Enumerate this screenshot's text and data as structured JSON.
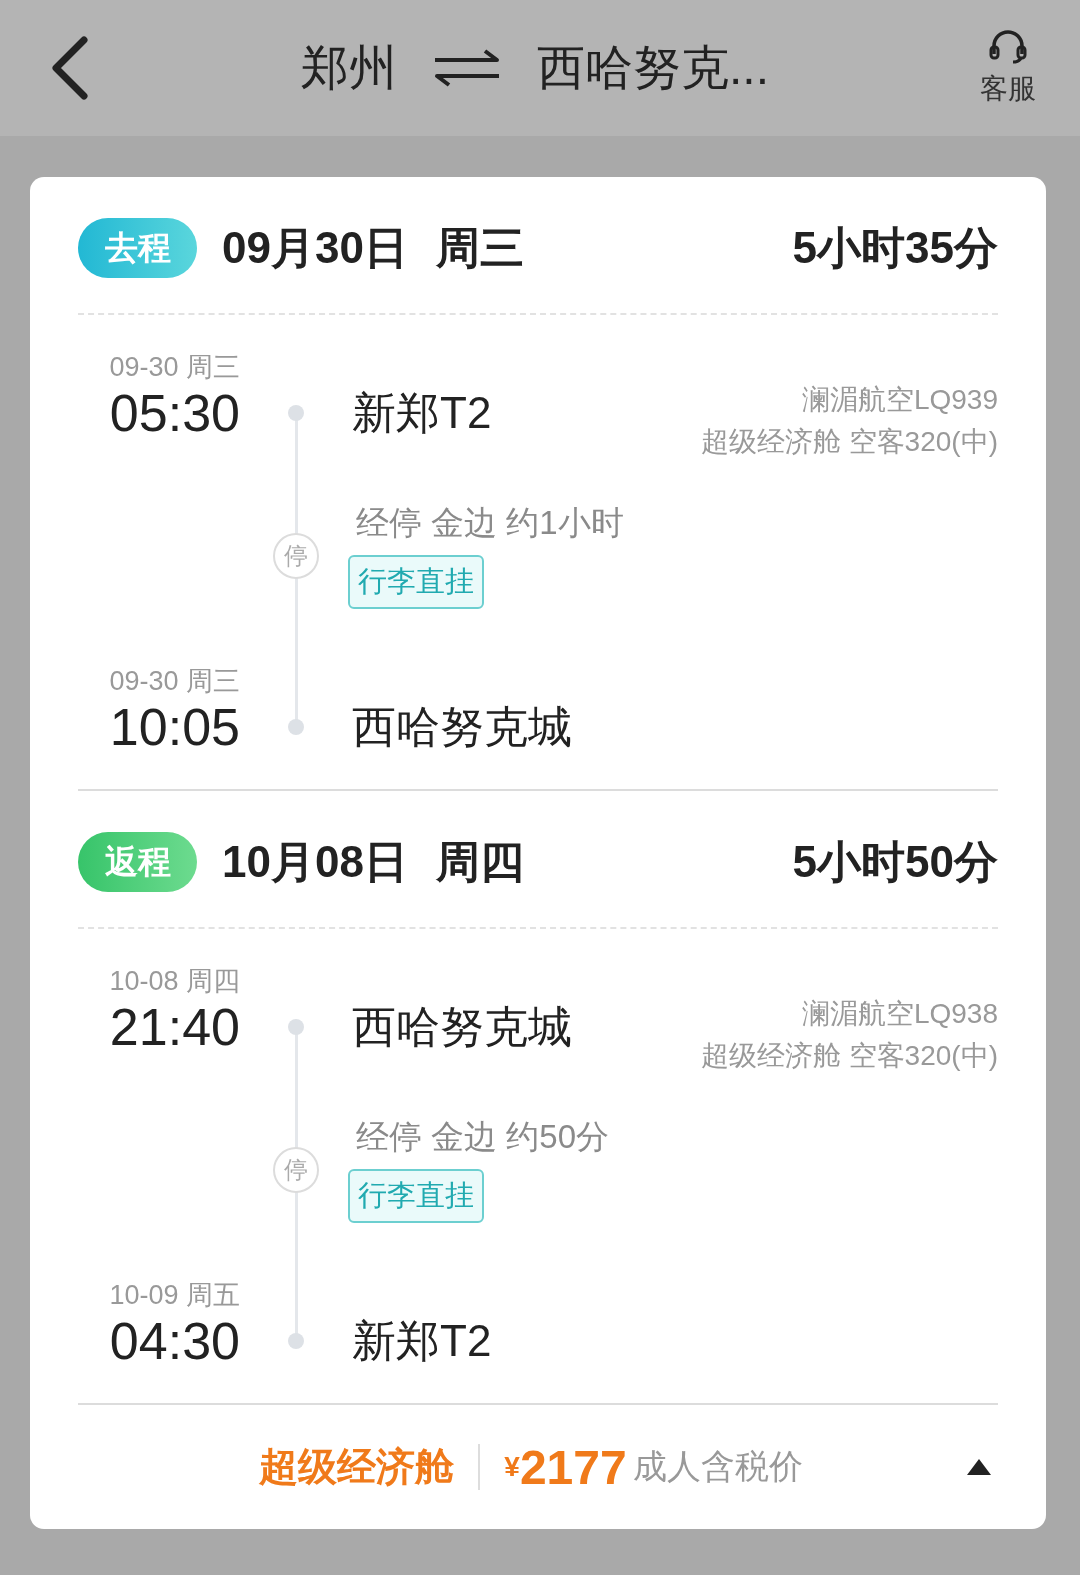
{
  "header": {
    "origin": "郑州",
    "destination": "西哈努克...",
    "service_label": "客服"
  },
  "legs": [
    {
      "kind": "outbound",
      "badge": "去程",
      "date": "09月30日",
      "weekday": "周三",
      "duration": "5小时35分",
      "departure": {
        "date": "09-30 周三",
        "time": "05:30",
        "airport": "新郑T2"
      },
      "flight": "澜湄航空LQ939",
      "cabin": "超级经济舱 空客320(中)",
      "stopover": {
        "text": "经停 金边 约1小时",
        "marker": "停",
        "tag": "行李直挂"
      },
      "arrival": {
        "date": "09-30 周三",
        "time": "10:05",
        "airport": "西哈努克城"
      }
    },
    {
      "kind": "return",
      "badge": "返程",
      "date": "10月08日",
      "weekday": "周四",
      "duration": "5小时50分",
      "departure": {
        "date": "10-08 周四",
        "time": "21:40",
        "airport": "西哈努克城"
      },
      "flight": "澜湄航空LQ938",
      "cabin": "超级经济舱 空客320(中)",
      "stopover": {
        "text": "经停 金边 约50分",
        "marker": "停",
        "tag": "行李直挂"
      },
      "arrival": {
        "date": "10-09 周五",
        "time": "04:30",
        "airport": "新郑T2"
      }
    }
  ],
  "footer": {
    "cabin_class": "超级经济舱",
    "currency": "¥",
    "price": "2177",
    "price_note": "成人含税价"
  }
}
